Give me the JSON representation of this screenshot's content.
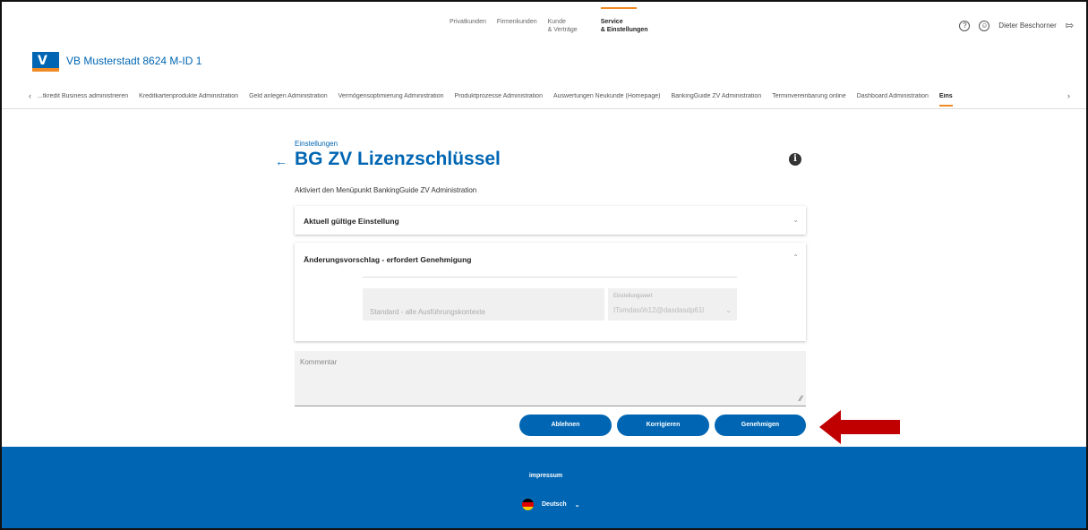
{
  "topnav": {
    "items": [
      "Privatkunden",
      "Firmenkunden"
    ],
    "kunde_line1": "Kunde",
    "kunde_line2": "& Verträge",
    "service_line1": "Service",
    "service_line2": "& Einstellungen"
  },
  "user": {
    "help_icon": "?",
    "name": "Dieter Beschorner"
  },
  "bank": {
    "name": "VB Musterstadt 8624 M-ID 1"
  },
  "subnav": {
    "items": [
      "...tkredit Business administrieren",
      "Kreditkartenprodukte Administration",
      "Geld anlegen Administration",
      "Vermögensoptimierung Administration",
      "Produktprozesse Administration",
      "Auswertungen Neukunde (Homepage)",
      "BankingGuide ZV Administration",
      "Terminvereinbarung online",
      "Dashboard Administration"
    ],
    "active": "Eins"
  },
  "page": {
    "breadcrumb": "Einstellungen",
    "title": "BG ZV Lizenzschlüssel",
    "description": "Aktiviert den Menüpunkt BankingGuide ZV Administration"
  },
  "panels": {
    "current_title": "Aktuell gültige Einstellung",
    "proposal_title": "Änderungsvorschlag - erfordert Genehmigung",
    "context_value": "Standard - alle Ausführungskontexte",
    "setting_label": "Einstellungswert",
    "setting_value": "ITsmdasöh12@dasdasdp61l"
  },
  "comment": {
    "placeholder": "Kommentar"
  },
  "buttons": {
    "reject": "Ablehnen",
    "correct": "Korrigieren",
    "approve": "Genehmigen"
  },
  "footer": {
    "impressum": "impressum",
    "language": "Deutsch"
  },
  "colors": {
    "brand_blue": "#0066b3",
    "accent_orange": "#f08a24",
    "arrow_red": "#c00000"
  }
}
